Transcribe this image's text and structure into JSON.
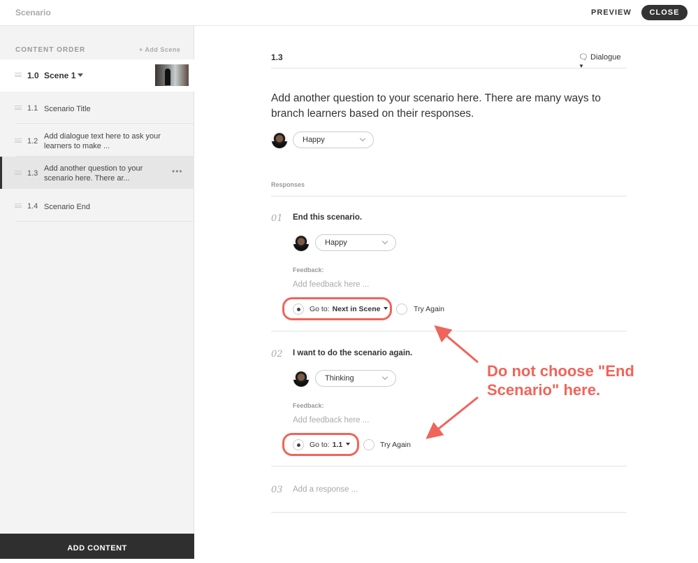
{
  "header": {
    "title": "Scenario",
    "preview": "PREVIEW",
    "close": "CLOSE"
  },
  "sidebar": {
    "content_order": "CONTENT ORDER",
    "add_scene": "+ Add Scene",
    "scene": {
      "num": "1.0",
      "name": "Scene 1"
    },
    "items": [
      {
        "num": "1.1",
        "text": "Scenario Title"
      },
      {
        "num": "1.2",
        "text": "Add dialogue text here to ask your learners to make ..."
      },
      {
        "num": "1.3",
        "text": "Add another question to your scenario here. There ar...",
        "more": "•••"
      },
      {
        "num": "1.4",
        "text": "Scenario End"
      }
    ],
    "add_content": "ADD CONTENT"
  },
  "main": {
    "slide": "1.3",
    "type": "Dialogue",
    "question": "Add another question to your scenario here. There are many ways to branch learners based on their responses.",
    "emotion": "Happy",
    "responses_label": "Responses",
    "responses": [
      {
        "num": "01",
        "text": "End this scenario.",
        "emotion": "Happy",
        "feedback_label": "Feedback:",
        "feedback_placeholder": "Add feedback here ...",
        "goto_label": "Go to:",
        "goto_value": "Next in Scene",
        "try_again": "Try Again"
      },
      {
        "num": "02",
        "text": "I want to do the scenario again.",
        "emotion": "Thinking",
        "feedback_label": "Feedback:",
        "feedback_placeholder": "Add feedback here ...",
        "goto_label": "Go to:",
        "goto_value": "1.1",
        "try_again": "Try Again"
      }
    ],
    "new_response": {
      "num": "03",
      "placeholder": "Add a response ..."
    }
  },
  "annotation": {
    "line1": "Do not choose \"End",
    "line2": "Scenario\" here.",
    "color": "#f0645a"
  }
}
